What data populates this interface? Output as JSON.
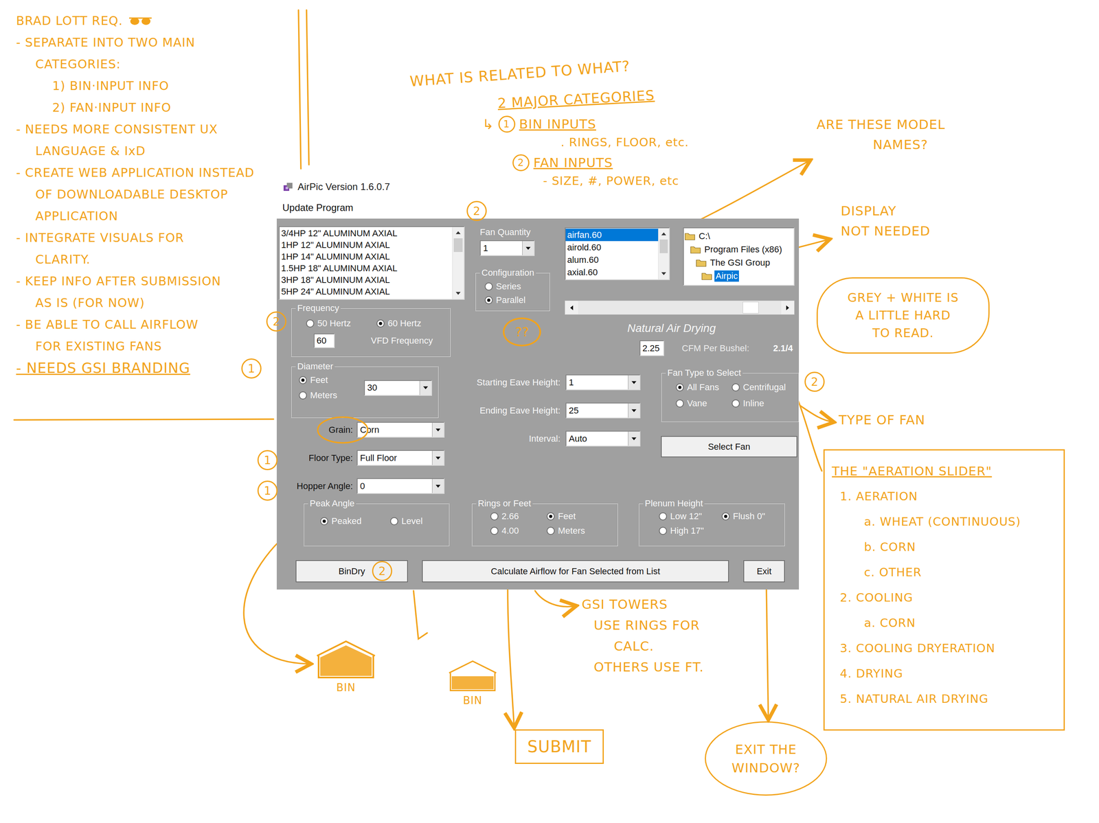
{
  "window": {
    "title": "AirPic Version 1.6.0.7",
    "menu": [
      "Update Program"
    ]
  },
  "fan_list": {
    "scroll_level": 0,
    "items": [
      {
        "label": "3/4HP 12\" ALUMINUM AXIAL",
        "selected": false
      },
      {
        "label": "1HP 12\" ALUMINUM AXIAL",
        "selected": false
      },
      {
        "label": "1HP 14\" ALUMINUM AXIAL",
        "selected": false
      },
      {
        "label": "1.5HP 18\" ALUMINUM AXIAL",
        "selected": false
      },
      {
        "label": "3HP 18\" ALUMINUM AXIAL",
        "selected": false
      },
      {
        "label": "5HP 24\" ALUMINUM AXIAL",
        "selected": false
      }
    ]
  },
  "fan_quantity": {
    "label": "Fan Quantity",
    "value": "1"
  },
  "configuration": {
    "label": "Configuration",
    "options": [
      {
        "label": "Series",
        "selected": false
      },
      {
        "label": "Parallel",
        "selected": true
      }
    ]
  },
  "files": {
    "scroll_level": 0,
    "items": [
      {
        "label": "airfan.60",
        "selected": true
      },
      {
        "label": "airold.60",
        "selected": false
      },
      {
        "label": "alum.60",
        "selected": false
      },
      {
        "label": "axial.60",
        "selected": false
      }
    ]
  },
  "folders": [
    {
      "label": "C:\\",
      "selected": false
    },
    {
      "label": "Program Files (x86)",
      "selected": false
    },
    {
      "label": "The GSI Group",
      "selected": false
    },
    {
      "label": "Airpic",
      "selected": true
    }
  ],
  "aeration_slider": {
    "level": 0.88
  },
  "mode_title": "Natural Air Drying",
  "cfm": {
    "value": "2.25",
    "label": "CFM Per Bushel:",
    "reading": "2.1/4"
  },
  "frequency": {
    "label": "Frequency",
    "options": [
      {
        "label": "50 Hertz",
        "selected": false
      },
      {
        "label": "60 Hertz",
        "selected": true
      }
    ],
    "vfd_value": "60",
    "vfd_label": "VFD Frequency"
  },
  "diameter": {
    "label": "Diameter",
    "options": [
      {
        "label": "Feet",
        "selected": true
      },
      {
        "label": "Meters",
        "selected": false
      }
    ],
    "value": "30"
  },
  "bin_fields": [
    {
      "label": "Grain:",
      "value": "Corn"
    },
    {
      "label": "Floor Type:",
      "value": "Full Floor"
    },
    {
      "label": "Hopper Angle:",
      "value": "0"
    }
  ],
  "eave_fields": [
    {
      "label": "Starting Eave Height:",
      "value": "1"
    },
    {
      "label": "Ending Eave Height:",
      "value": "25"
    },
    {
      "label": "Interval:",
      "value": "Auto"
    }
  ],
  "fan_type": {
    "label": "Fan Type to Select",
    "options": [
      {
        "label": "All Fans",
        "selected": true
      },
      {
        "label": "Centrifugal",
        "selected": false
      },
      {
        "label": "Vane",
        "selected": false
      },
      {
        "label": "Inline",
        "selected": false
      }
    ]
  },
  "peak_angle": {
    "label": "Peak Angle",
    "options": [
      {
        "label": "Peaked",
        "selected": true
      },
      {
        "label": "Level",
        "selected": false
      }
    ]
  },
  "rings_or_feet": {
    "label": "Rings or Feet",
    "options": [
      {
        "label": "2.66",
        "selected": false
      },
      {
        "label": "Feet",
        "selected": true
      },
      {
        "label": "4.00",
        "selected": false
      },
      {
        "label": "Meters",
        "selected": false
      }
    ]
  },
  "plenum_height": {
    "label": "Plenum Height",
    "options": [
      {
        "label": "Low 12\"",
        "selected": false
      },
      {
        "label": "Flush 0\"",
        "selected": true
      },
      {
        "label": "High 17\"",
        "selected": false
      }
    ]
  },
  "buttons": {
    "select_fan": "Select Fan",
    "bin_dry": "BinDry",
    "calculate": "Calculate Airflow for Fan Selected from List",
    "exit": "Exit"
  },
  "requirements": {
    "title": "BRAD LOTT REQ.",
    "items": [
      {
        "kind": "normal",
        "lines": [
          "- SEPARATE INTO TWO MAIN",
          "CATEGORIES:"
        ],
        "sub": [
          "1) BIN·INPUT INFO",
          "2) FAN·INPUT INFO"
        ]
      },
      {
        "kind": "normal",
        "lines": [
          "- NEEDS MORE CONSISTENT UX",
          "LANGUAGE & IxD"
        ],
        "sub": []
      },
      {
        "kind": "normal",
        "lines": [
          "- CREATE WEB APPLICATION INSTEAD",
          "OF DOWNLOADABLE DESKTOP",
          "APPLICATION"
        ],
        "sub": []
      },
      {
        "kind": "normal",
        "lines": [
          "- INTEGRATE VISUALS FOR",
          "CLARITY."
        ],
        "sub": []
      },
      {
        "kind": "normal",
        "lines": [
          "- KEEP INFO AFTER SUBMISSION",
          "AS IS (FOR NOW)"
        ],
        "sub": []
      },
      {
        "kind": "normal",
        "lines": [
          "- BE ABLE TO CALL AIRFLOW",
          "FOR EXISTING FANS"
        ],
        "sub": []
      },
      {
        "kind": "emphasis",
        "lines": [
          "- NEEDS GSI BRANDING"
        ],
        "sub": []
      }
    ]
  },
  "categories": {
    "question": "WHAT IS RELATED TO WHAT?",
    "title": "2 MAJOR CATEGORIES",
    "items": [
      {
        "prefix": "↳",
        "number": "1",
        "name": "BIN INPUTS",
        "detail": ". RINGS, FLOOR, etc."
      },
      {
        "prefix": "",
        "number": "2",
        "name": "FAN INPUTS",
        "detail": "- SIZE, #, POWER, etc"
      }
    ]
  },
  "notes": [
    {
      "kind": "plain",
      "lines": [
        "ARE THESE MODEL",
        "NAMES?"
      ]
    },
    {
      "kind": "plain",
      "lines": [
        "DISPLAY",
        "NOT NEEDED"
      ]
    },
    {
      "kind": "cloud",
      "lines": [
        "GREY + WHITE IS",
        "A LITTLE HARD",
        "TO READ."
      ]
    },
    {
      "kind": "plain",
      "lines": [
        "TYPE OF FAN"
      ]
    },
    {
      "kind": "plain",
      "lines": [
        "GSI TOWERS",
        "USE RINGS FOR",
        "CALC.",
        "OTHERS USE FT."
      ]
    },
    {
      "kind": "box",
      "lines": [
        "SUBMIT"
      ]
    },
    {
      "kind": "ellipse",
      "lines": [
        "EXIT THE",
        "WINDOW?"
      ]
    }
  ],
  "aeration_notes": {
    "title": "THE \"AERATION SLIDER\"",
    "items": [
      {
        "label": "1. AERATION",
        "sub": [
          "a. WHEAT (CONTINUOUS)",
          "b. CORN",
          "c. OTHER"
        ]
      },
      {
        "label": "2. COOLING",
        "sub": [
          "a. CORN"
        ]
      },
      {
        "label": "3. COOLING DRYERATION",
        "sub": []
      },
      {
        "label": "4. DRYING",
        "sub": []
      },
      {
        "label": "5. NATURAL AIR DRYING",
        "sub": []
      }
    ]
  },
  "bins": [
    {
      "kind": "peaked",
      "label": "BIN"
    },
    {
      "kind": "level",
      "label": "BIN"
    }
  ],
  "marks": [
    "2",
    "??",
    "2",
    "1",
    "1",
    "1",
    "2",
    "2"
  ]
}
